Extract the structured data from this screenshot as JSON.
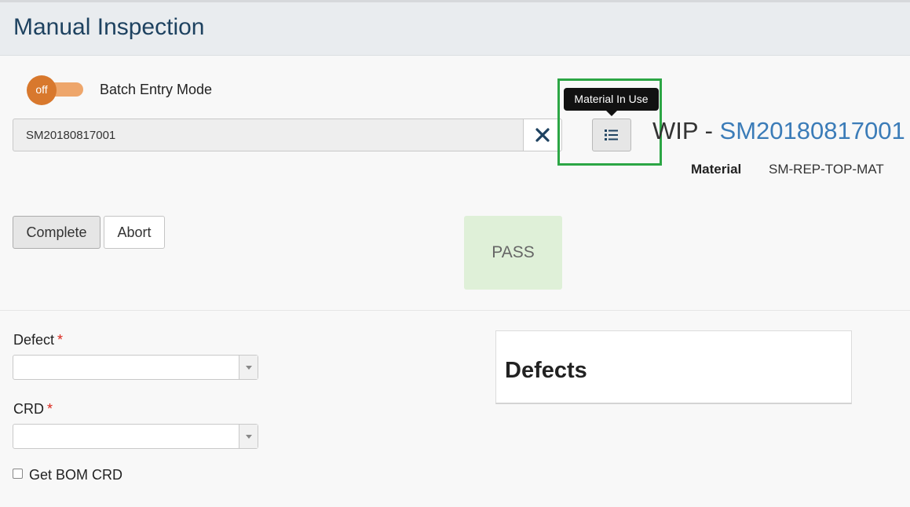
{
  "header": {
    "title": "Manual Inspection"
  },
  "batch_toggle": {
    "state_label": "off",
    "label": "Batch Entry Mode"
  },
  "wip_search": {
    "value": "SM20180817001",
    "clear_icon": "close-icon"
  },
  "material_in_use": {
    "tooltip": "Material In Use",
    "icon": "list-icon"
  },
  "wip_info": {
    "prefix": "WIP - ",
    "id": "SM20180817001",
    "material_label": "Material",
    "material_value": "SM-REP-TOP-MAT"
  },
  "actions": {
    "complete_label": "Complete",
    "abort_label": "Abort"
  },
  "result": {
    "status": "PASS"
  },
  "form": {
    "defect_label": "Defect",
    "crd_label": "CRD",
    "required_mark": "*",
    "bom_checkbox_label": "Get BOM CRD"
  },
  "defects_panel": {
    "title": "Defects"
  },
  "colors": {
    "toggle_knob": "#d8782d",
    "toggle_track": "#eea66b",
    "wip_id": "#3b7cb8",
    "pass_bg": "#dff0d8",
    "highlight": "#2ca645",
    "required": "#d9261c"
  }
}
